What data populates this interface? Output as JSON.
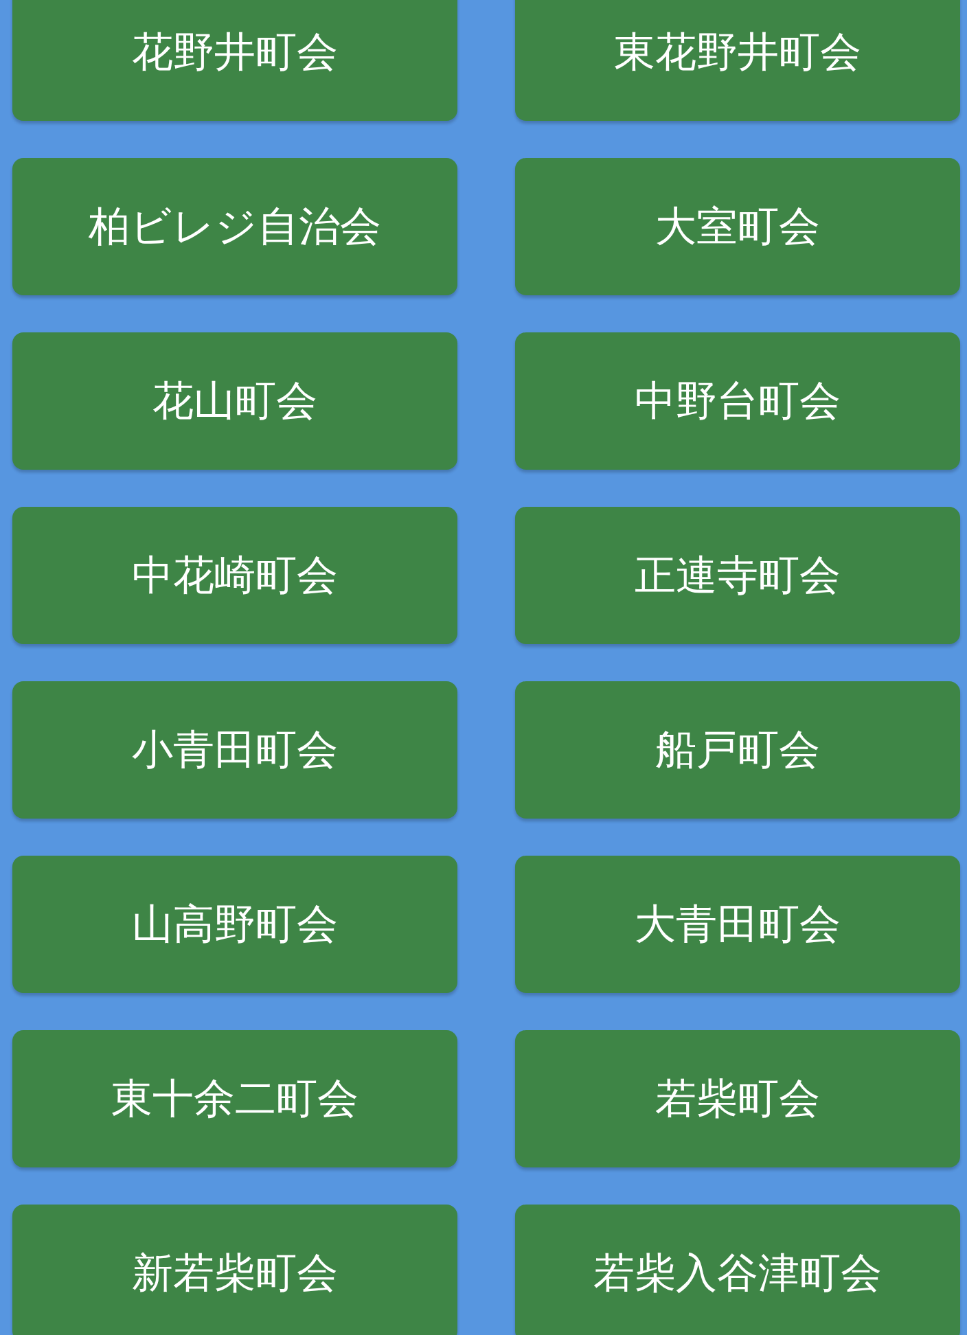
{
  "buttons": [
    {
      "label": "花野井町会"
    },
    {
      "label": "東花野井町会"
    },
    {
      "label": "柏ビレジ自治会"
    },
    {
      "label": "大室町会"
    },
    {
      "label": "花山町会"
    },
    {
      "label": "中野台町会"
    },
    {
      "label": "中花崎町会"
    },
    {
      "label": "正連寺町会"
    },
    {
      "label": "小青田町会"
    },
    {
      "label": "船戸町会"
    },
    {
      "label": "山高野町会"
    },
    {
      "label": "大青田町会"
    },
    {
      "label": "東十余二町会"
    },
    {
      "label": "若柴町会"
    },
    {
      "label": "新若柴町会"
    },
    {
      "label": "若柴入谷津町会"
    }
  ]
}
